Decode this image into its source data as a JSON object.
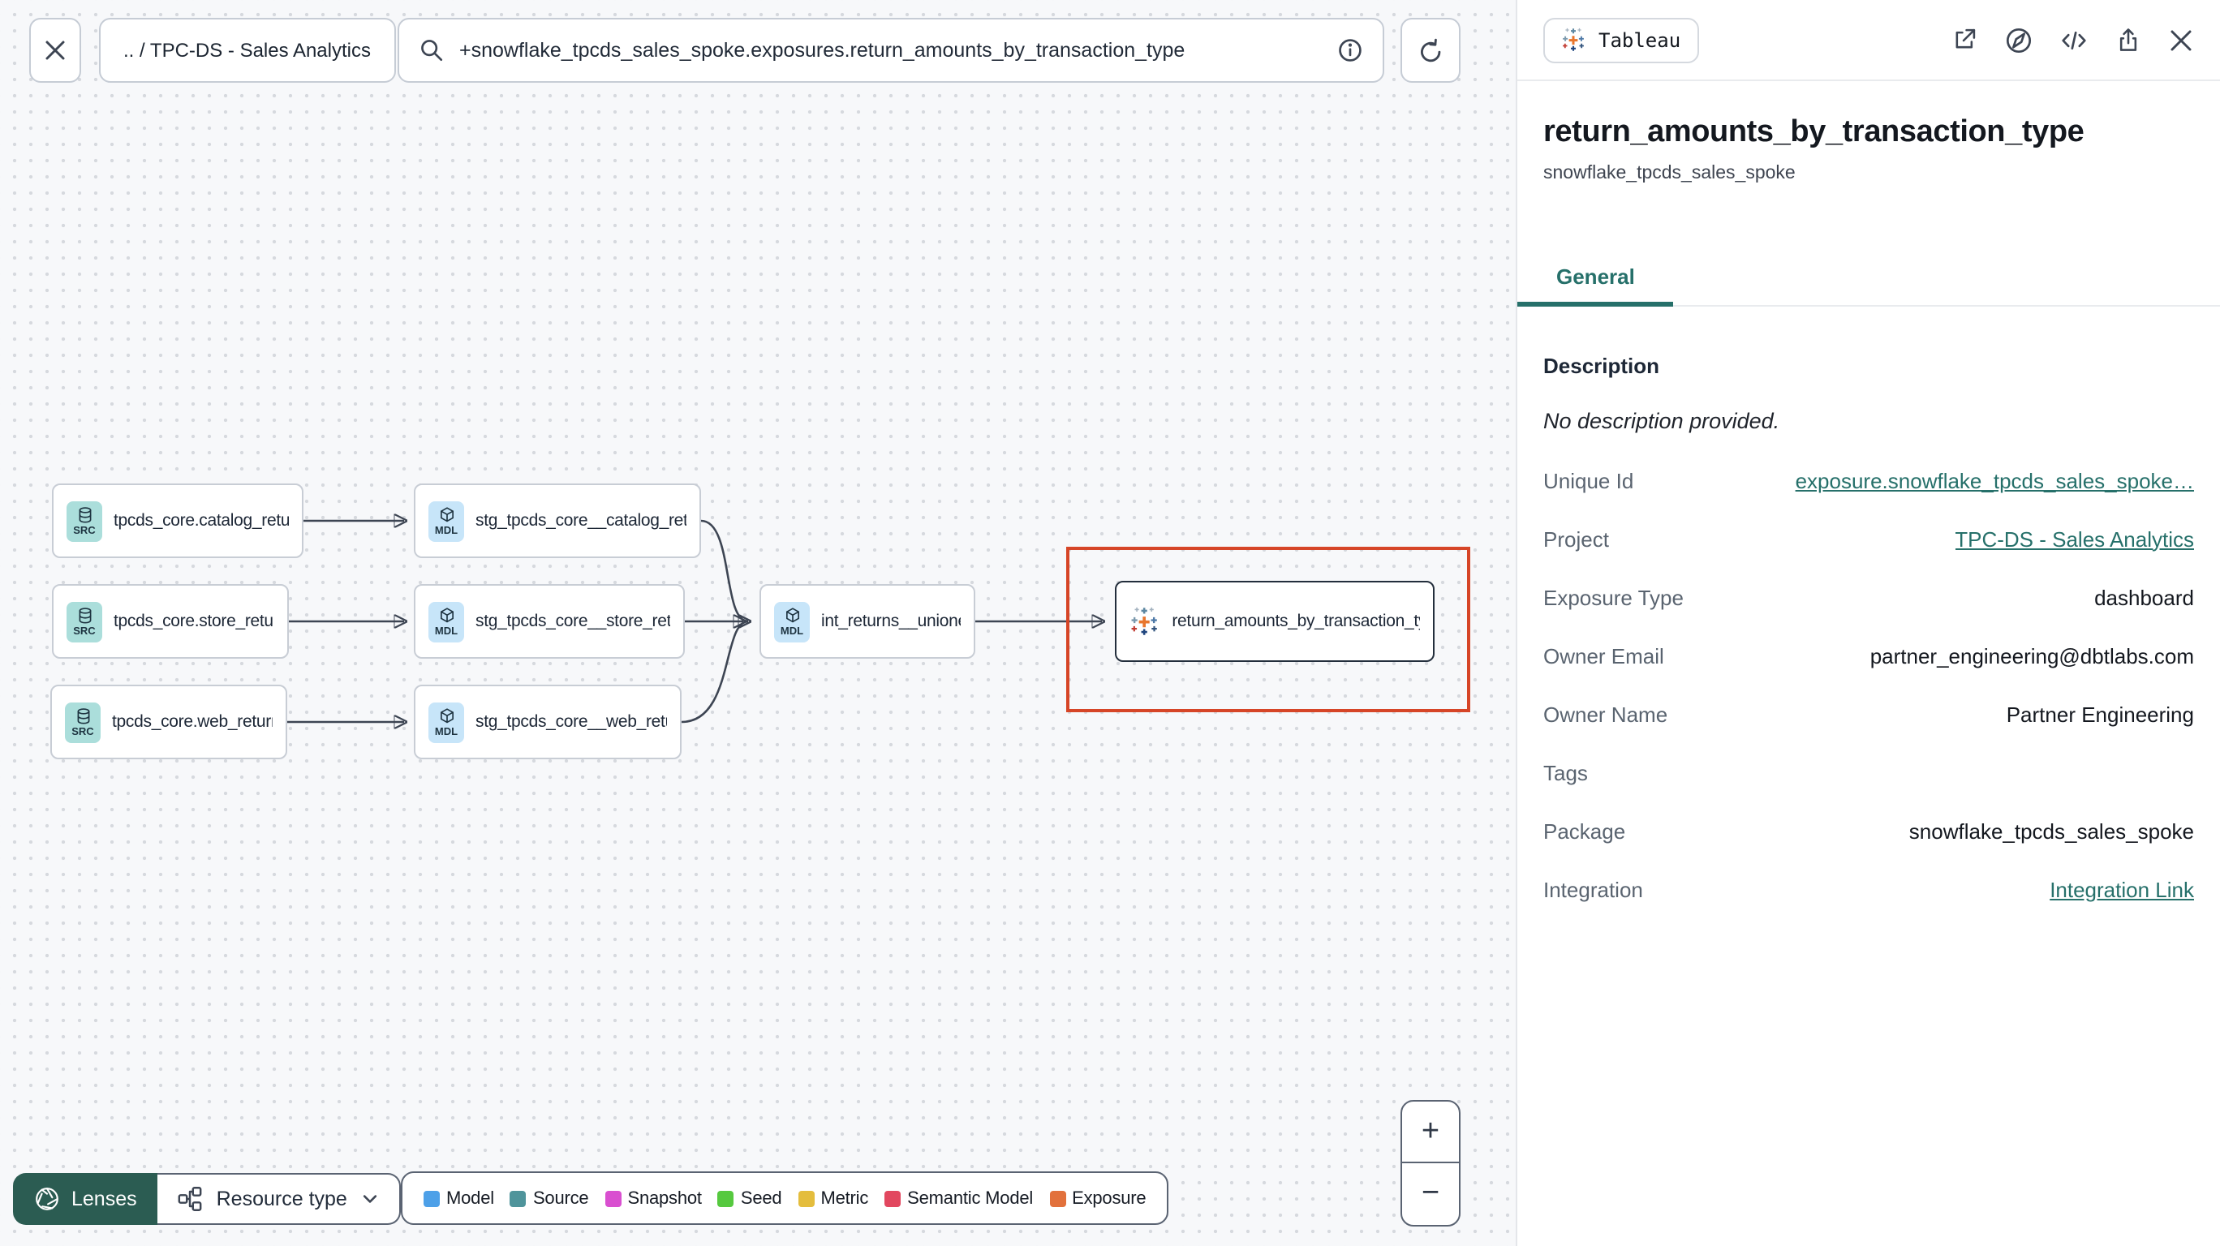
{
  "toolbar": {
    "breadcrumb": ".. / TPC-DS - Sales Analytics",
    "search_query": "+snowflake_tpcds_sales_spoke.exposures.return_amounts_by_transaction_type"
  },
  "graph": {
    "nodes": [
      {
        "label": "tpcds_core.catalog_returns",
        "type": "source",
        "badge": "SRC"
      },
      {
        "label": "tpcds_core.store_returns",
        "type": "source",
        "badge": "SRC"
      },
      {
        "label": "tpcds_core.web_returns",
        "type": "source",
        "badge": "SRC"
      },
      {
        "label": "stg_tpcds_core__catalog_returns",
        "type": "model",
        "badge": "MDL"
      },
      {
        "label": "stg_tpcds_core__store_returns",
        "type": "model",
        "badge": "MDL"
      },
      {
        "label": "stg_tpcds_core__web_returns",
        "type": "model",
        "badge": "MDL"
      },
      {
        "label": "int_returns__unioned",
        "type": "model",
        "badge": "MDL"
      },
      {
        "label": "return_amounts_by_transaction_type",
        "type": "exposure",
        "badge": ""
      }
    ],
    "selected_node": "return_amounts_by_transaction_type",
    "highlight_color": "#d64527"
  },
  "controls": {
    "lenses_label": "Lenses",
    "resource_type_label": "Resource type",
    "zoom_in": "+",
    "zoom_out": "−"
  },
  "legend": {
    "items": [
      {
        "label": "Model",
        "color": "#4da0e8"
      },
      {
        "label": "Source",
        "color": "#4f949b"
      },
      {
        "label": "Snapshot",
        "color": "#d94fd0"
      },
      {
        "label": "Seed",
        "color": "#56c93f"
      },
      {
        "label": "Metric",
        "color": "#e4bd3d"
      },
      {
        "label": "Semantic Model",
        "color": "#e2475f"
      },
      {
        "label": "Exposure",
        "color": "#e2713c"
      }
    ]
  },
  "panel": {
    "badge_label": "Tableau",
    "title": "return_amounts_by_transaction_type",
    "subtitle": "snowflake_tpcds_sales_spoke",
    "tabs": [
      {
        "label": "General",
        "active": true
      }
    ],
    "accent_color": "#26706a",
    "description_heading": "Description",
    "description_empty": "No description provided.",
    "fields": [
      {
        "label": "Unique Id",
        "value": "exposure.snowflake_tpcds_sales_spoke…",
        "link": true
      },
      {
        "label": "Project",
        "value": "TPC-DS - Sales Analytics",
        "link": true
      },
      {
        "label": "Exposure Type",
        "value": "dashboard",
        "link": false
      },
      {
        "label": "Owner Email",
        "value": "partner_engineering@dbtlabs.com",
        "link": false
      },
      {
        "label": "Owner Name",
        "value": "Partner Engineering",
        "link": false
      },
      {
        "label": "Tags",
        "value": "",
        "link": false
      },
      {
        "label": "Package",
        "value": "snowflake_tpcds_sales_spoke",
        "link": false
      },
      {
        "label": "Integration",
        "value": "Integration Link",
        "link": true
      }
    ]
  },
  "icons": {
    "toolbar": [
      "close-icon",
      "search-icon",
      "info-icon",
      "refresh-icon"
    ],
    "panel_header": [
      "tableau-logo-icon",
      "external-link-icon",
      "compass-icon",
      "code-icon",
      "share-icon",
      "close-icon"
    ],
    "graph": [
      "database-icon",
      "cube-icon",
      "tableau-logo-icon"
    ],
    "footer": [
      "aperture-icon",
      "resource-type-icon",
      "chevron-down-icon"
    ],
    "zoom": [
      "plus-icon",
      "minus-icon"
    ]
  }
}
